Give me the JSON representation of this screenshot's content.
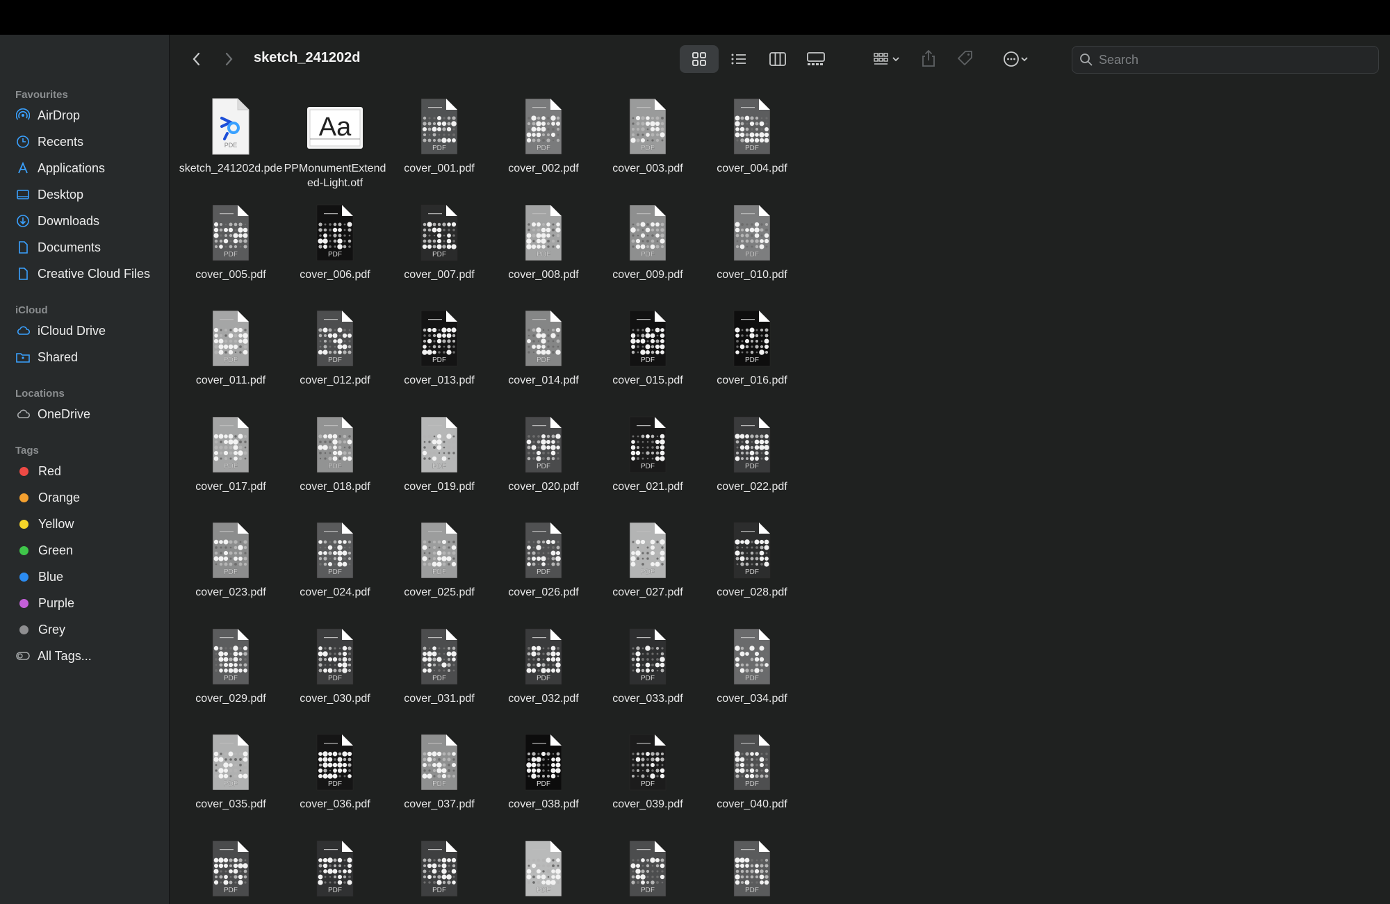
{
  "window": {
    "title": "sketch_241202d"
  },
  "sidebar": {
    "sections": [
      {
        "heading": "Favourites",
        "items": [
          {
            "label": "AirDrop",
            "icon": "airdrop-icon"
          },
          {
            "label": "Recents",
            "icon": "clock-icon"
          },
          {
            "label": "Applications",
            "icon": "applications-icon"
          },
          {
            "label": "Desktop",
            "icon": "desktop-icon"
          },
          {
            "label": "Downloads",
            "icon": "download-icon"
          },
          {
            "label": "Documents",
            "icon": "document-icon"
          },
          {
            "label": "Creative Cloud Files",
            "icon": "document-icon"
          }
        ]
      },
      {
        "heading": "iCloud",
        "items": [
          {
            "label": "iCloud Drive",
            "icon": "cloud-icon"
          },
          {
            "label": "Shared",
            "icon": "shared-folder-icon"
          }
        ]
      },
      {
        "heading": "Locations",
        "items": [
          {
            "label": "OneDrive",
            "icon": "cloud-icon"
          }
        ]
      },
      {
        "heading": "Tags",
        "items": [
          {
            "label": "Red",
            "color": "#ee4a45"
          },
          {
            "label": "Orange",
            "color": "#f4a02f"
          },
          {
            "label": "Yellow",
            "color": "#f6d629"
          },
          {
            "label": "Green",
            "color": "#3fc64a"
          },
          {
            "label": "Blue",
            "color": "#2b8cf2"
          },
          {
            "label": "Purple",
            "color": "#c35fd8"
          },
          {
            "label": "Grey",
            "color": "#8e8e90"
          },
          {
            "label": "All Tags...",
            "icon": "all-tags-icon"
          }
        ]
      }
    ]
  },
  "toolbar": {
    "back_icon": "chevron-left-icon",
    "forward_icon": "chevron-right-icon",
    "views": [
      "icon-view-icon",
      "list-view-icon",
      "column-view-icon",
      "gallery-view-icon"
    ],
    "search_placeholder": "Search"
  },
  "files": [
    {
      "name": "sketch_241202d.pde",
      "kind": "pde"
    },
    {
      "name": "PPMonumentExtended-Light.otf",
      "kind": "font",
      "preview": "Aa"
    },
    {
      "name": "cover_001.pdf",
      "kind": "pdf",
      "tone": "#505253"
    },
    {
      "name": "cover_002.pdf",
      "kind": "pdf",
      "tone": "#7a7b7c"
    },
    {
      "name": "cover_003.pdf",
      "kind": "pdf",
      "tone": "#9a9b9b"
    },
    {
      "name": "cover_004.pdf",
      "kind": "pdf",
      "tone": "#5c5d5e"
    },
    {
      "name": "cover_005.pdf",
      "kind": "pdf",
      "tone": "#5a5b5c"
    },
    {
      "name": "cover_006.pdf",
      "kind": "pdf",
      "tone": "#111111"
    },
    {
      "name": "cover_007.pdf",
      "kind": "pdf",
      "tone": "#2a2b2b"
    },
    {
      "name": "cover_008.pdf",
      "kind": "pdf",
      "tone": "#a3a4a4"
    },
    {
      "name": "cover_009.pdf",
      "kind": "pdf",
      "tone": "#8e8f8f"
    },
    {
      "name": "cover_010.pdf",
      "kind": "pdf",
      "tone": "#7d7e7f"
    },
    {
      "name": "cover_011.pdf",
      "kind": "pdf",
      "tone": "#a5a6a6"
    },
    {
      "name": "cover_012.pdf",
      "kind": "pdf",
      "tone": "#4d4e4f"
    },
    {
      "name": "cover_013.pdf",
      "kind": "pdf",
      "tone": "#141414"
    },
    {
      "name": "cover_014.pdf",
      "kind": "pdf",
      "tone": "#858686"
    },
    {
      "name": "cover_015.pdf",
      "kind": "pdf",
      "tone": "#121212"
    },
    {
      "name": "cover_016.pdf",
      "kind": "pdf",
      "tone": "#0e0e0e"
    },
    {
      "name": "cover_017.pdf",
      "kind": "pdf",
      "tone": "#a4a5a5"
    },
    {
      "name": "cover_018.pdf",
      "kind": "pdf",
      "tone": "#929393"
    },
    {
      "name": "cover_019.pdf",
      "kind": "pdf",
      "tone": "#b6b7b7"
    },
    {
      "name": "cover_020.pdf",
      "kind": "pdf",
      "tone": "#4a4b4c"
    },
    {
      "name": "cover_021.pdf",
      "kind": "pdf",
      "tone": "#1a1a1a"
    },
    {
      "name": "cover_022.pdf",
      "kind": "pdf",
      "tone": "#3a3b3c"
    },
    {
      "name": "cover_023.pdf",
      "kind": "pdf",
      "tone": "#8c8d8d"
    },
    {
      "name": "cover_024.pdf",
      "kind": "pdf",
      "tone": "#5a5b5c"
    },
    {
      "name": "cover_025.pdf",
      "kind": "pdf",
      "tone": "#9c9d9d"
    },
    {
      "name": "cover_026.pdf",
      "kind": "pdf",
      "tone": "#505152"
    },
    {
      "name": "cover_027.pdf",
      "kind": "pdf",
      "tone": "#b3b4b4"
    },
    {
      "name": "cover_028.pdf",
      "kind": "pdf",
      "tone": "#2c2d2d"
    },
    {
      "name": "cover_029.pdf",
      "kind": "pdf",
      "tone": "#5c5d5e"
    },
    {
      "name": "cover_030.pdf",
      "kind": "pdf",
      "tone": "#3c3d3e"
    },
    {
      "name": "cover_031.pdf",
      "kind": "pdf",
      "tone": "#4c4d4e"
    },
    {
      "name": "cover_032.pdf",
      "kind": "pdf",
      "tone": "#3a3b3c"
    },
    {
      "name": "cover_033.pdf",
      "kind": "pdf",
      "tone": "#2e2f30"
    },
    {
      "name": "cover_034.pdf",
      "kind": "pdf",
      "tone": "#6a6b6c"
    },
    {
      "name": "cover_035.pdf",
      "kind": "pdf",
      "tone": "#b0b1b1"
    },
    {
      "name": "cover_036.pdf",
      "kind": "pdf",
      "tone": "#151515"
    },
    {
      "name": "cover_037.pdf",
      "kind": "pdf",
      "tone": "#8f9090"
    },
    {
      "name": "cover_038.pdf",
      "kind": "pdf",
      "tone": "#0c0c0c"
    },
    {
      "name": "cover_039.pdf",
      "kind": "pdf",
      "tone": "#1c1c1c"
    },
    {
      "name": "cover_040.pdf",
      "kind": "pdf",
      "tone": "#4e4f50"
    },
    {
      "name": "",
      "kind": "pdf",
      "tone": "#4a4b4c"
    },
    {
      "name": "",
      "kind": "pdf",
      "tone": "#303132"
    },
    {
      "name": "",
      "kind": "pdf",
      "tone": "#3e3f40"
    },
    {
      "name": "",
      "kind": "pdf",
      "tone": "#b9baba"
    },
    {
      "name": "",
      "kind": "pdf",
      "tone": "#4c4d4e"
    },
    {
      "name": "",
      "kind": "pdf",
      "tone": "#5a5b5c"
    }
  ]
}
